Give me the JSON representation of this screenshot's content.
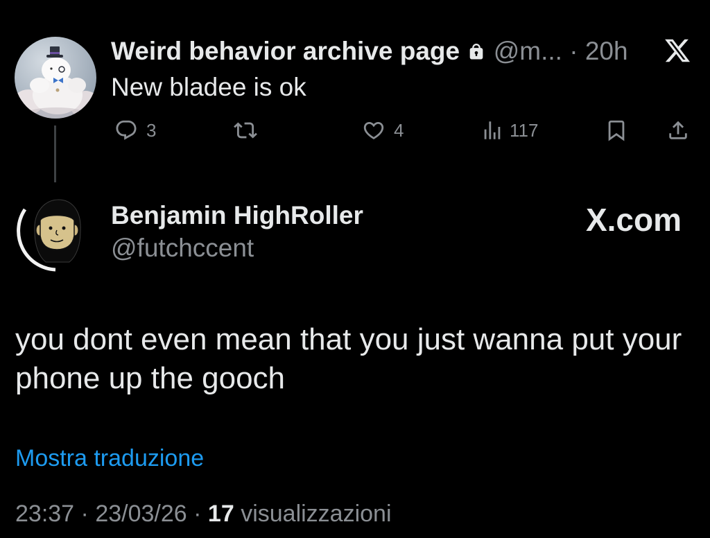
{
  "theme": {
    "background": "#000000",
    "text": "#e7e9ea",
    "secondary": "#8b8f94",
    "link": "#1d9bf0",
    "thread_line": "#3e4144"
  },
  "parent_tweet": {
    "display_name": "Weird behavior archive page",
    "protected_icon": "lock-icon",
    "handle": "@m...",
    "separator": "·",
    "time": "20h",
    "platform_icon": "x-logo-icon",
    "text": "New bladee is ok",
    "actions": {
      "replies": "3",
      "likes": "4",
      "views": "117"
    },
    "action_icons": [
      "reply-icon",
      "repost-icon",
      "like-icon",
      "views-icon",
      "bookmark-icon",
      "share-icon"
    ]
  },
  "reply_tweet": {
    "display_name": "Benjamin HighRoller",
    "handle": "@futchccent",
    "site_label": "X.com",
    "text": "you dont even mean that you just wanna put your phone up the gooch",
    "translate_label": "Mostra traduzione",
    "time": "23:37",
    "separator": "·",
    "date": "23/03/26",
    "views_count": "17",
    "views_label": "visualizzazioni"
  }
}
